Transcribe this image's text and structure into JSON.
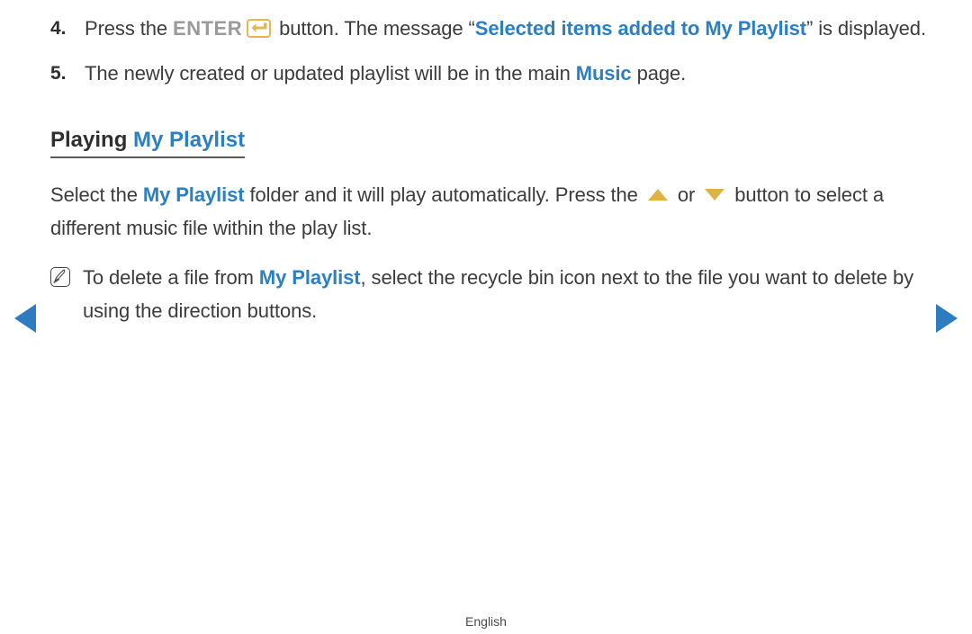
{
  "steps": [
    {
      "number": "4.",
      "parts": [
        {
          "type": "text",
          "value": "Press the "
        },
        {
          "type": "key",
          "value": "ENTER"
        },
        {
          "type": "icon",
          "value": "enter-key-icon"
        },
        {
          "type": "text",
          "value": " button. The message “"
        },
        {
          "type": "blue",
          "value": "Selected items added to My Playlist"
        },
        {
          "type": "text",
          "value": "” is displayed."
        }
      ],
      "plain": "Press the ENTER button. The message “Selected items added to My Playlist” is displayed.",
      "line1_prefix": "Press the ",
      "key_label": "ENTER",
      "line1_mid": " button. The message “",
      "blue_run": "Selected items added to My",
      "line2_blue": "Playlist",
      "line2_tail": "” is displayed."
    },
    {
      "number": "5.",
      "prefix": "The newly created or updated playlist will be in the main ",
      "blue": "Music",
      "suffix": " page."
    }
  ],
  "section": {
    "heading_plain": "Playing",
    "heading_blue": "My Playlist"
  },
  "paragraph": {
    "p1": "Select the ",
    "p1_blue": "My Playlist",
    "p2": " folder and it will play automatically. Press the ",
    "up_icon": "triangle-up-icon",
    "p3": " or ",
    "down_icon": "triangle-down-icon",
    "p4": " button to select a different music file within the play list."
  },
  "note": {
    "icon": "note-pencil-icon",
    "prefix": "To delete a file from ",
    "blue": "My Playlist",
    "suffix": ", select the recycle bin icon next to the file you want to delete by using the direction buttons."
  },
  "nav": {
    "prev_icon": "prev-page-arrow-icon",
    "next_icon": "next-page-arrow-icon"
  },
  "footer": {
    "language": "English"
  },
  "colors": {
    "link_blue": "#2c7fc0",
    "key_gray": "#9a9a9e",
    "accent_gold": "#e0b246",
    "nav_blue": "#2e7bbf",
    "body_text": "#3c3c3c"
  }
}
